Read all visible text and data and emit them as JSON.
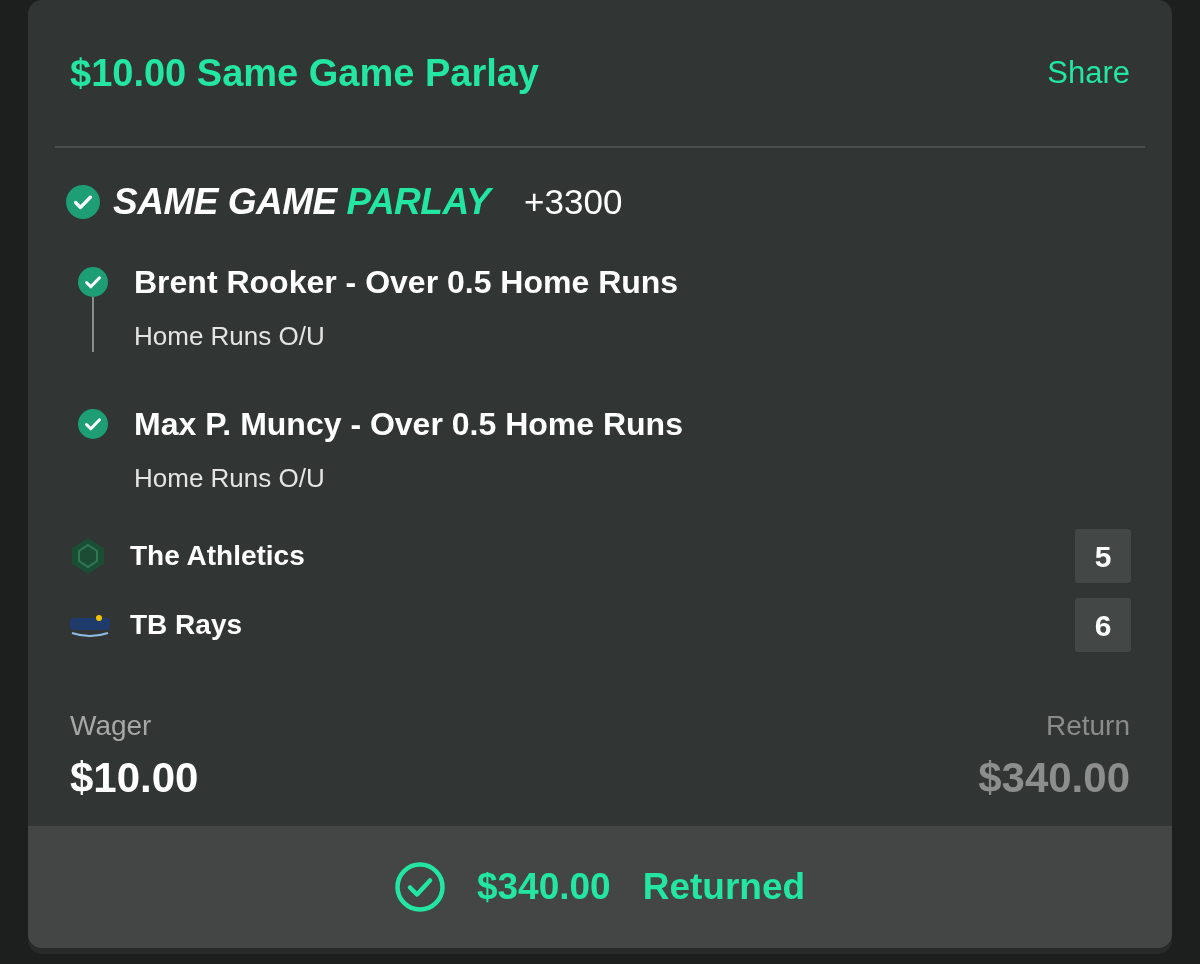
{
  "header": {
    "title": "$10.00 Same Game Parlay",
    "share": "Share"
  },
  "parlay": {
    "label_prefix": "SAME GAME",
    "label_highlight": "PARLAY",
    "odds": "+3300",
    "won": true
  },
  "legs": [
    {
      "selection": "Brent Rooker - Over 0.5 Home Runs",
      "market": "Home Runs O/U",
      "won": true
    },
    {
      "selection": "Max P. Muncy - Over 0.5 Home Runs",
      "market": "Home Runs O/U",
      "won": true
    }
  ],
  "teams": [
    {
      "kind": "athletics",
      "name": "The Athletics",
      "score": "5"
    },
    {
      "kind": "rays",
      "name": "TB Rays",
      "score": "6"
    }
  ],
  "wager": {
    "label": "Wager",
    "amount": "$10.00"
  },
  "return": {
    "label": "Return",
    "amount": "$340.00"
  },
  "result": {
    "amount": "$340.00",
    "status": "Returned",
    "won": true
  }
}
